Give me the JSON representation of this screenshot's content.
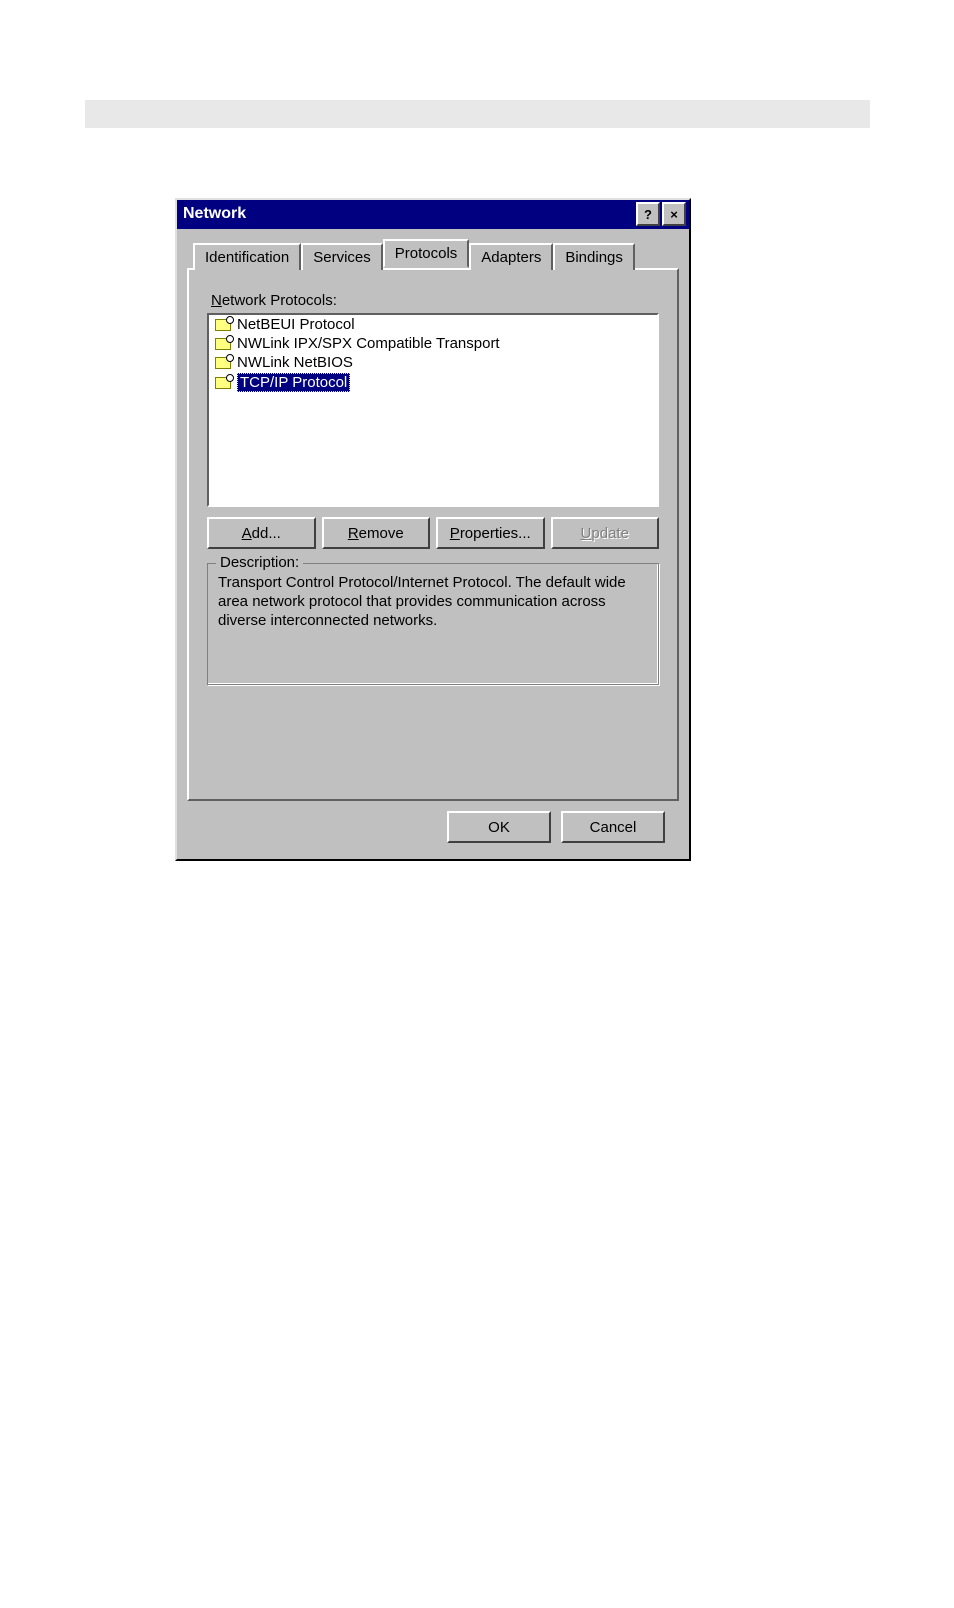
{
  "dialog": {
    "title": "Network",
    "sysbuttons": {
      "help": "?",
      "close": "×"
    },
    "tabs": [
      "Identification",
      "Services",
      "Protocols",
      "Adapters",
      "Bindings"
    ],
    "active_tab_index": 2,
    "list_label_pre": "N",
    "list_label_post": "etwork Protocols:",
    "protocols": [
      {
        "name": "NetBEUI Protocol",
        "selected": false
      },
      {
        "name": "NWLink IPX/SPX Compatible Transport",
        "selected": false
      },
      {
        "name": "NWLink NetBIOS",
        "selected": false
      },
      {
        "name": "TCP/IP Protocol",
        "selected": true
      }
    ],
    "buttons": {
      "add": {
        "u": "A",
        "rest": "dd..."
      },
      "remove": {
        "u": "R",
        "rest": "emove"
      },
      "properties": {
        "u": "P",
        "rest": "roperties..."
      },
      "update": {
        "u": "U",
        "rest": "pdate",
        "disabled": true
      }
    },
    "description_caption": "Description:",
    "description_text": "Transport Control Protocol/Internet Protocol. The default wide area network protocol that provides communication across diverse interconnected networks.",
    "ok": "OK",
    "cancel": "Cancel"
  }
}
